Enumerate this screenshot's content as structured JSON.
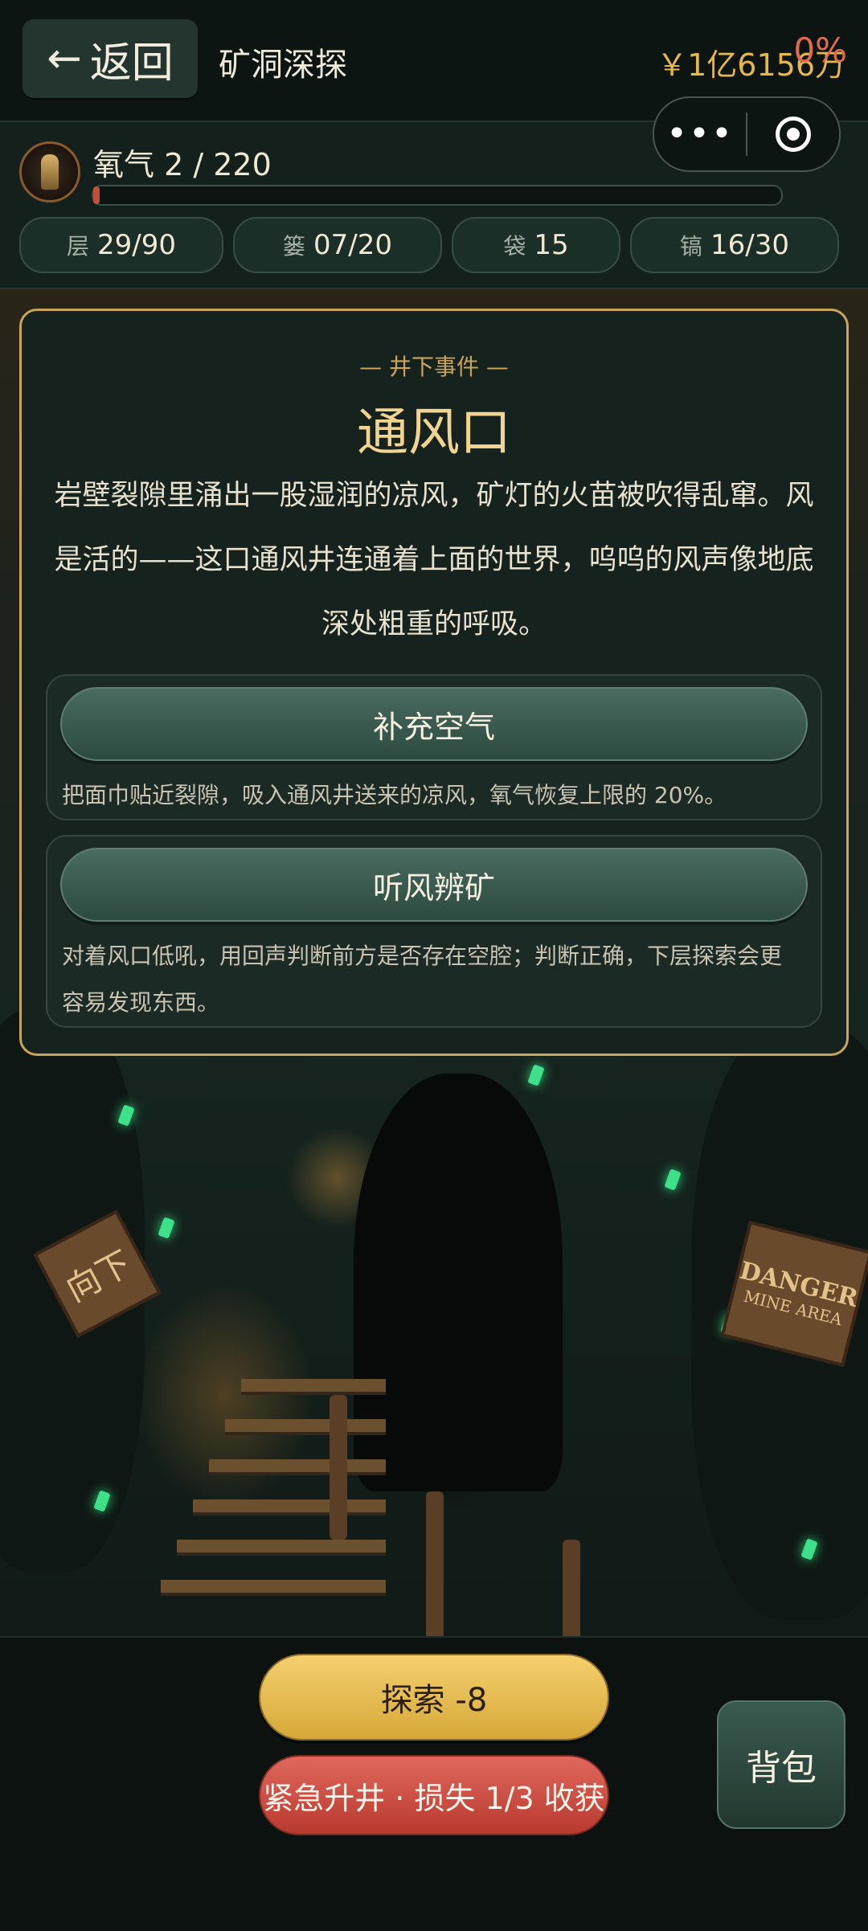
{
  "header": {
    "back_label": "返回",
    "back_icon": "arrow-left-icon",
    "title": "矿洞深探",
    "money": "￥1亿6156万"
  },
  "capsule": {
    "more_icon": "more-dots-icon",
    "close_icon": "target-circle-icon"
  },
  "status": {
    "oxygen_label": "氧气 2 / 220",
    "oxygen_fraction": 0.009,
    "oxygen_percent": "0%",
    "chips": [
      {
        "key": "层",
        "value": "29/90"
      },
      {
        "key": "篓",
        "value": "07/20"
      },
      {
        "key": "袋",
        "value": "15"
      },
      {
        "key": "镐",
        "value": "16/30"
      }
    ]
  },
  "event": {
    "kicker": "— 井下事件 —",
    "title": "通风口",
    "description": "岩壁裂隙里涌出一股湿润的凉风，矿灯的火苗被吹得乱窜。风是活的——这口通风井连通着上面的世界，呜呜的风声像地底深处粗重的呼吸。",
    "options": [
      {
        "label": "补充空气",
        "desc": "把面巾贴近裂隙，吸入通风井送来的凉风，氧气恢复上限的 20%。"
      },
      {
        "label": "听风辨矿",
        "desc": "对着风口低吼，用回声判断前方是否存在空腔；判断正确，下层探索会更容易发现东西。"
      }
    ]
  },
  "scene": {
    "sign_left": "向下",
    "sign_right_line1": "DANGER",
    "sign_right_line2": "MINE AREA"
  },
  "actions": {
    "explore": "探索 -8",
    "escape": "紧急升井 · 损失 1/3 收获",
    "bag": "背包"
  },
  "colors": {
    "accent_gold": "#c9a45a",
    "oxygen_red": "#e06a50",
    "money": "#e6b64e",
    "gem": "#3ee08a"
  }
}
